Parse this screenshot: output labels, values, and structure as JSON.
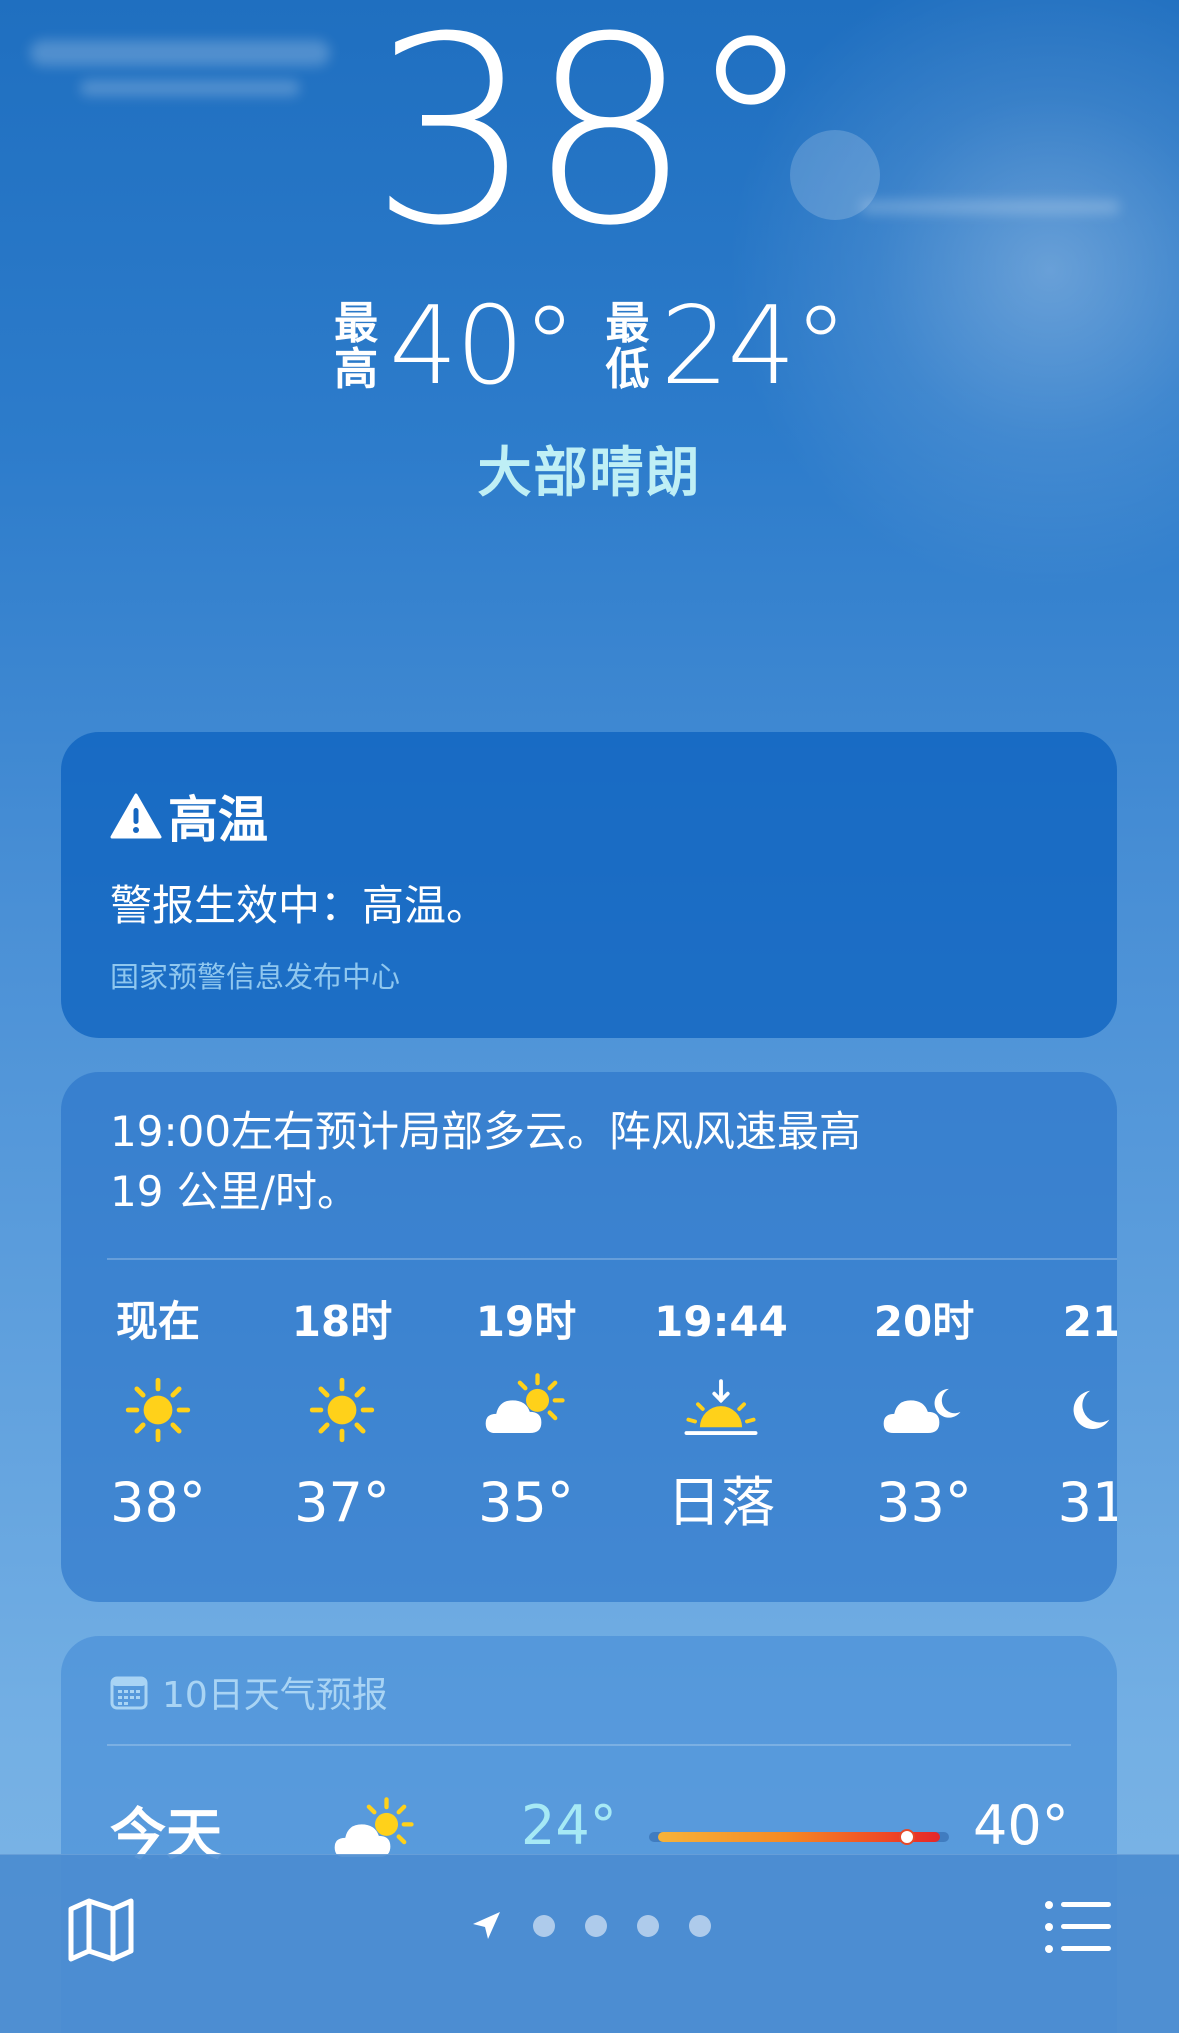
{
  "current": {
    "temperature": "38°",
    "high_label_top": "最",
    "high_label_bottom": "高",
    "high": "40°",
    "low_label_top": "最",
    "low_label_bottom": "低",
    "low": "24°",
    "condition": "大部晴朗"
  },
  "alert": {
    "icon": "warning-triangle-icon",
    "title": "高温",
    "body": "警报生效中：高温。",
    "source": "国家预警信息发布中心"
  },
  "hourly": {
    "summary_line1": "19:00左右预计局部多云。阵风风速最高",
    "summary_line2": "19 公里/时。",
    "items": [
      {
        "label": "现在",
        "icon": "sun-icon",
        "temp": "38°"
      },
      {
        "label": "18时",
        "icon": "sun-icon",
        "temp": "37°"
      },
      {
        "label": "19时",
        "icon": "partly-cloudy-day-icon",
        "temp": "35°"
      },
      {
        "label": "19:44",
        "icon": "sunset-icon",
        "temp": "日落"
      },
      {
        "label": "20时",
        "icon": "partly-cloudy-night-icon",
        "temp": "33°"
      },
      {
        "label": "21",
        "icon": "moon-icon",
        "temp": "31"
      }
    ]
  },
  "daily": {
    "header_icon": "calendar-icon",
    "header": "10日天气预报",
    "rows": [
      {
        "day": "今天",
        "icon": "partly-cloudy-day-icon",
        "low": "24°",
        "high": "40°",
        "range_start": 0.03,
        "range_end": 0.97,
        "current_position": 0.86
      }
    ]
  },
  "toolbar": {
    "map_icon": "map-icon",
    "location_icon": "location-arrow-icon",
    "page_count": 4,
    "list_icon": "list-icon"
  },
  "colors": {
    "condition_text": "#bfeff5",
    "low_temp_text": "#a6e9f5",
    "sun_yellow": "#ffd11a",
    "alert_source_text": "#8fc7ef"
  }
}
